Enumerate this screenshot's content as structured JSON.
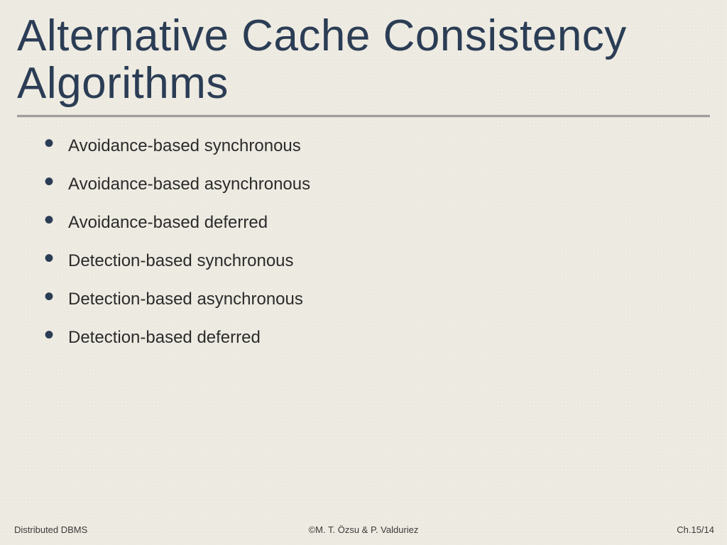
{
  "title": "Alternative Cache Consistency Algorithms",
  "bullets": [
    "Avoidance-based synchronous",
    "Avoidance-based asynchronous",
    "Avoidance-based deferred",
    "Detection-based synchronous",
    "Detection-based asynchronous",
    "Detection-based deferred"
  ],
  "footer": {
    "left": "Distributed DBMS",
    "center": "©M. T. Özsu & P. Valduriez",
    "right": "Ch.15/14"
  }
}
